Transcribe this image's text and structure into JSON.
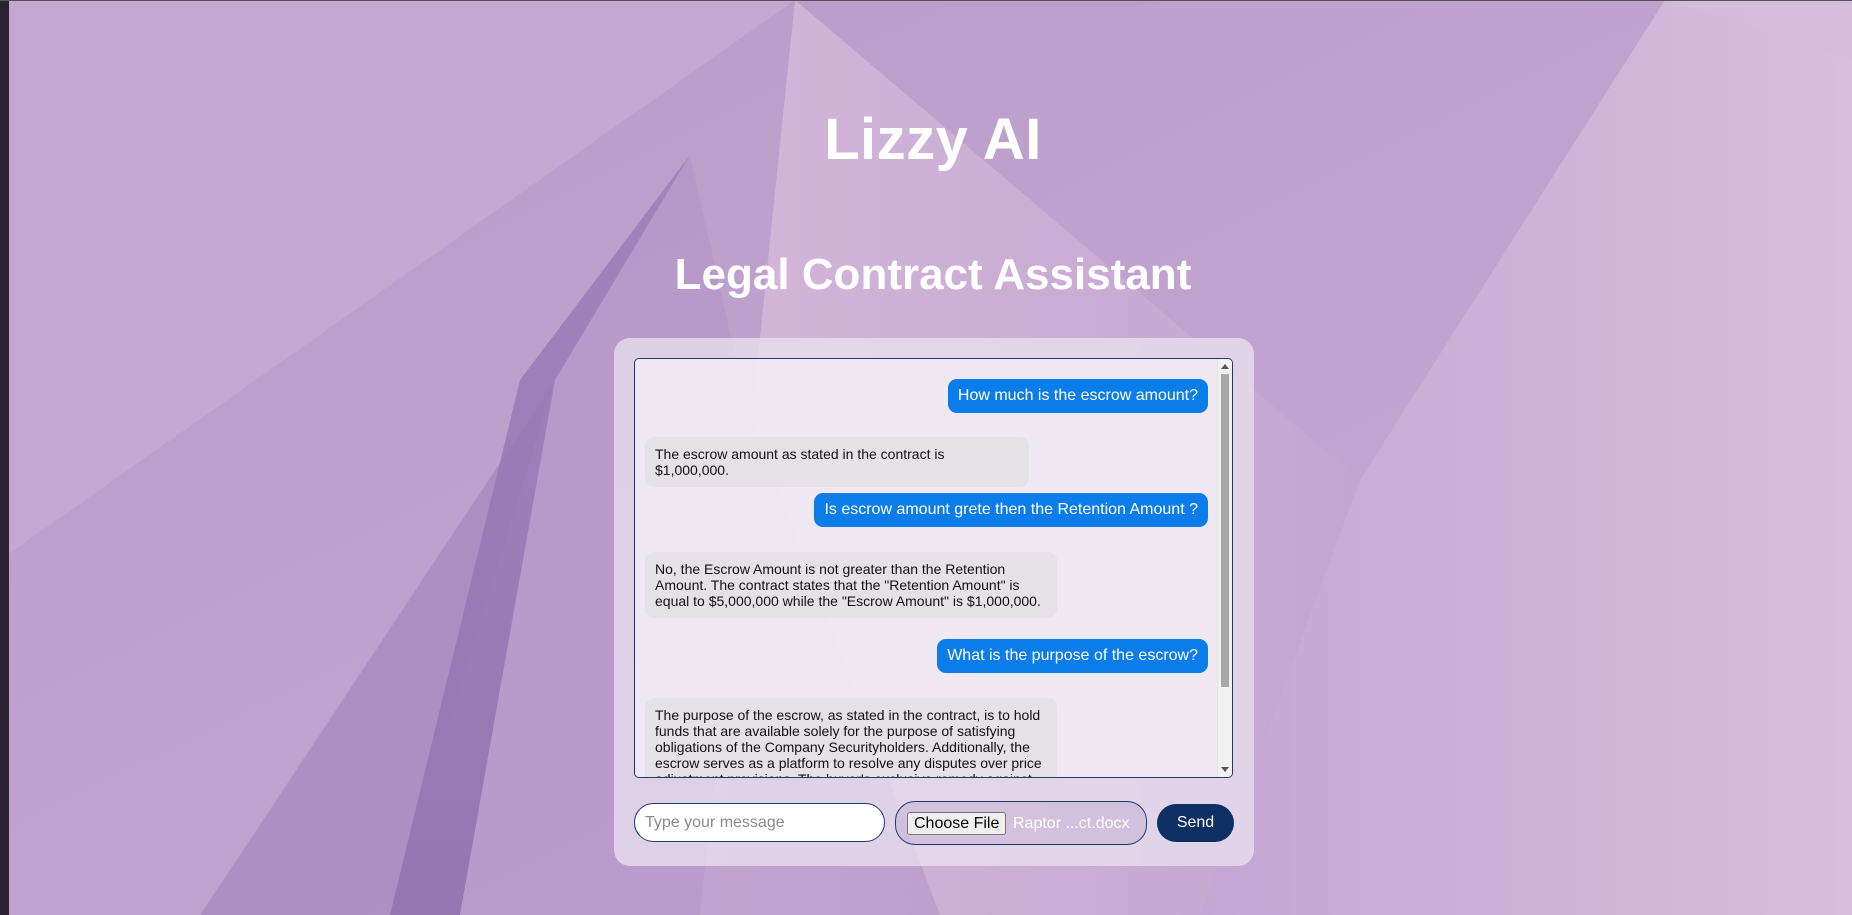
{
  "header": {
    "title": "Lizzy AI",
    "subtitle": "Legal Contract Assistant"
  },
  "chat": {
    "messages": [
      {
        "role": "user",
        "text": "How much is the escrow amount?"
      },
      {
        "role": "bot",
        "text": "The escrow amount as stated in the contract is $1,000,000."
      },
      {
        "role": "user",
        "text": "Is escrow amount grete then the Retention Amount ?"
      },
      {
        "role": "bot",
        "text": "No, the Escrow Amount is not greater than the Retention Amount. The contract states that the \"Retention Amount\" is equal to $5,000,000 while the \"Escrow Amount\" is $1,000,000."
      },
      {
        "role": "user",
        "text": "What is the purpose of the escrow?"
      },
      {
        "role": "bot",
        "text": "The purpose of the escrow, as stated in the contract, is to hold funds that are available solely for the purpose of satisfying obligations of the Company Securityholders. Additionally, the escrow serves as a platform to resolve any disputes over price adjustment provisions. The buyer's exclusive remedy against"
      }
    ]
  },
  "input": {
    "placeholder": "Type your message",
    "value": ""
  },
  "file": {
    "button_label": "Choose File",
    "selected_name": "Raptor ...ct.docx"
  },
  "send": {
    "label": "Send"
  },
  "colors": {
    "user_bubble": "#0b7dea",
    "bot_bubble": "#e4e2e6",
    "accent": "#0d2f63",
    "border": "#1d3a6e"
  }
}
